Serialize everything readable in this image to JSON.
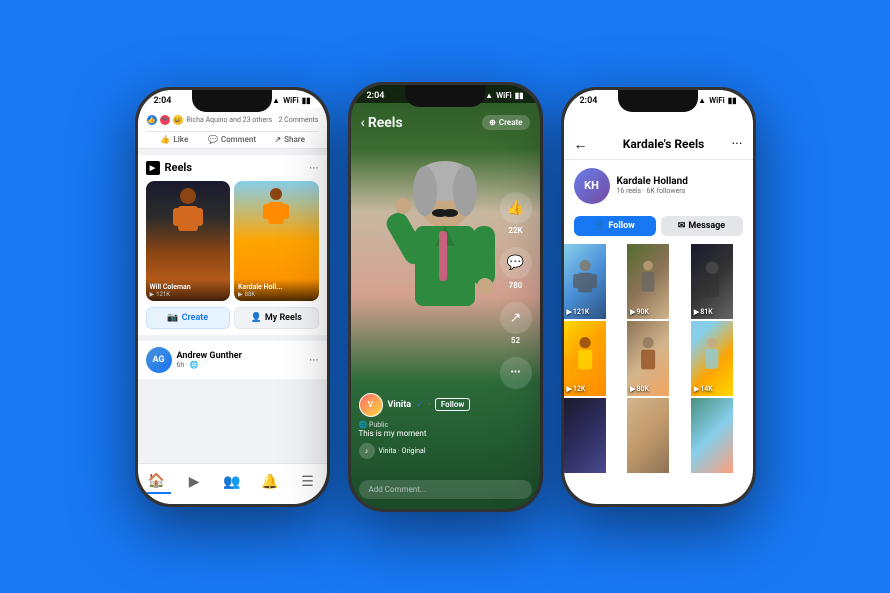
{
  "background": "#1877F2",
  "phones": {
    "left": {
      "status_time": "2:04",
      "reaction_text": "Richa Aquino and 23 others",
      "comments_count": "2 Comments",
      "like_label": "Like",
      "comment_label": "Comment",
      "share_label": "Share",
      "reels_section_title": "Reels",
      "reel1_creator": "Will Coleman",
      "reel1_views": "121K",
      "reel2_creator": "Kardale Holl...",
      "reel2_views": "88K",
      "create_btn": "Create",
      "my_reels_btn": "My Reels",
      "post_author": "Andrew Gunther",
      "post_time": "6h · 🌐",
      "nav_home": "🏠",
      "nav_video": "▶",
      "nav_people": "👥",
      "nav_bell": "🔔",
      "nav_menu": "☰"
    },
    "center": {
      "status_time": "2:04",
      "back_label": "Reels",
      "create_label": "Create",
      "username": "Vinita",
      "verified": "✓",
      "follow_label": "Follow",
      "public_label": "Public",
      "caption": "This is my moment",
      "audio_label": "Vinita · Original",
      "like_count": "22K",
      "comment_count": "780",
      "share_count": "52",
      "more_icon": "···",
      "comment_placeholder": "Add Comment..."
    },
    "right": {
      "status_time": "2:04",
      "back_icon": "←",
      "title": "Kardale's Reels",
      "menu_icon": "···",
      "profile_name": "Kardale Holland",
      "profile_stats": "16 reels · 6K followers",
      "follow_label": "Follow",
      "message_label": "Message",
      "reels": [
        {
          "views": "121K",
          "bg": "bg-r1"
        },
        {
          "views": "90K",
          "bg": "bg-r2"
        },
        {
          "views": "81K",
          "bg": "bg-r3"
        },
        {
          "views": "12K",
          "bg": "bg-r4"
        },
        {
          "views": "80K",
          "bg": "bg-r5"
        },
        {
          "views": "14K",
          "bg": "bg-r6"
        },
        {
          "views": "",
          "bg": "bg-r7"
        },
        {
          "views": "",
          "bg": "bg-r8"
        },
        {
          "views": "",
          "bg": "bg-r9"
        }
      ]
    }
  }
}
